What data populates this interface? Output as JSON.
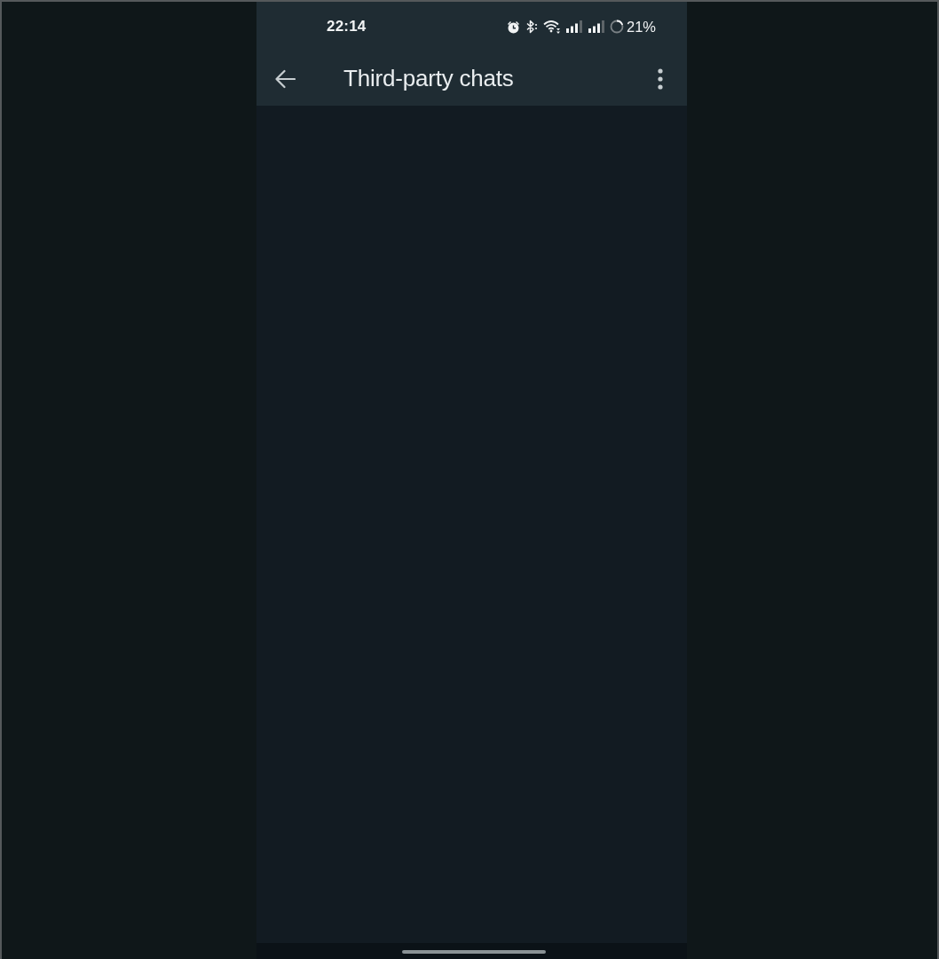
{
  "status_bar": {
    "time": "22:14",
    "battery": "21%"
  },
  "app_bar": {
    "title": "Third-party chats"
  }
}
